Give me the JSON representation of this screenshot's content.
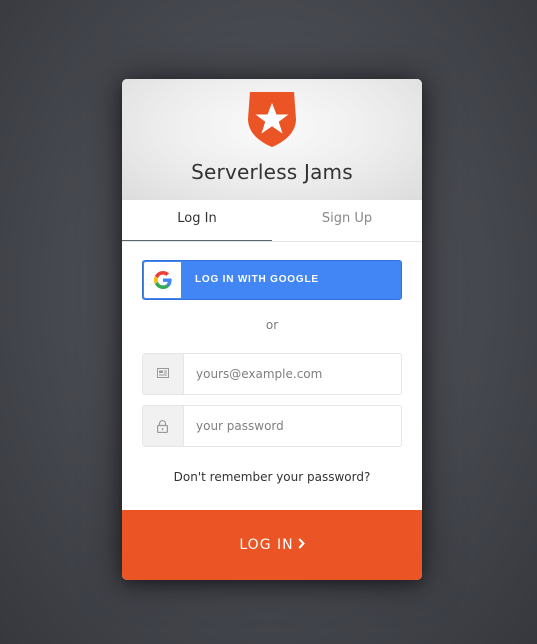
{
  "app": {
    "title": "Serverless Jams",
    "logo_icon": "auth0-shield-star-icon",
    "brand_color": "#eb5424"
  },
  "tabs": [
    {
      "label": "Log In",
      "active": true
    },
    {
      "label": "Sign Up",
      "active": false
    }
  ],
  "social": {
    "google_label": "LOG IN WITH GOOGLE",
    "google_icon": "google-g-icon",
    "google_color": "#4285f4"
  },
  "separator": "or",
  "email": {
    "placeholder": "yours@example.com",
    "value": "",
    "icon": "envelope-icon"
  },
  "password": {
    "placeholder": "your password",
    "value": "",
    "icon": "lock-icon"
  },
  "forgot_link": "Don't remember your password?",
  "submit": {
    "label": "LOG IN",
    "icon": "chevron-right-icon"
  }
}
